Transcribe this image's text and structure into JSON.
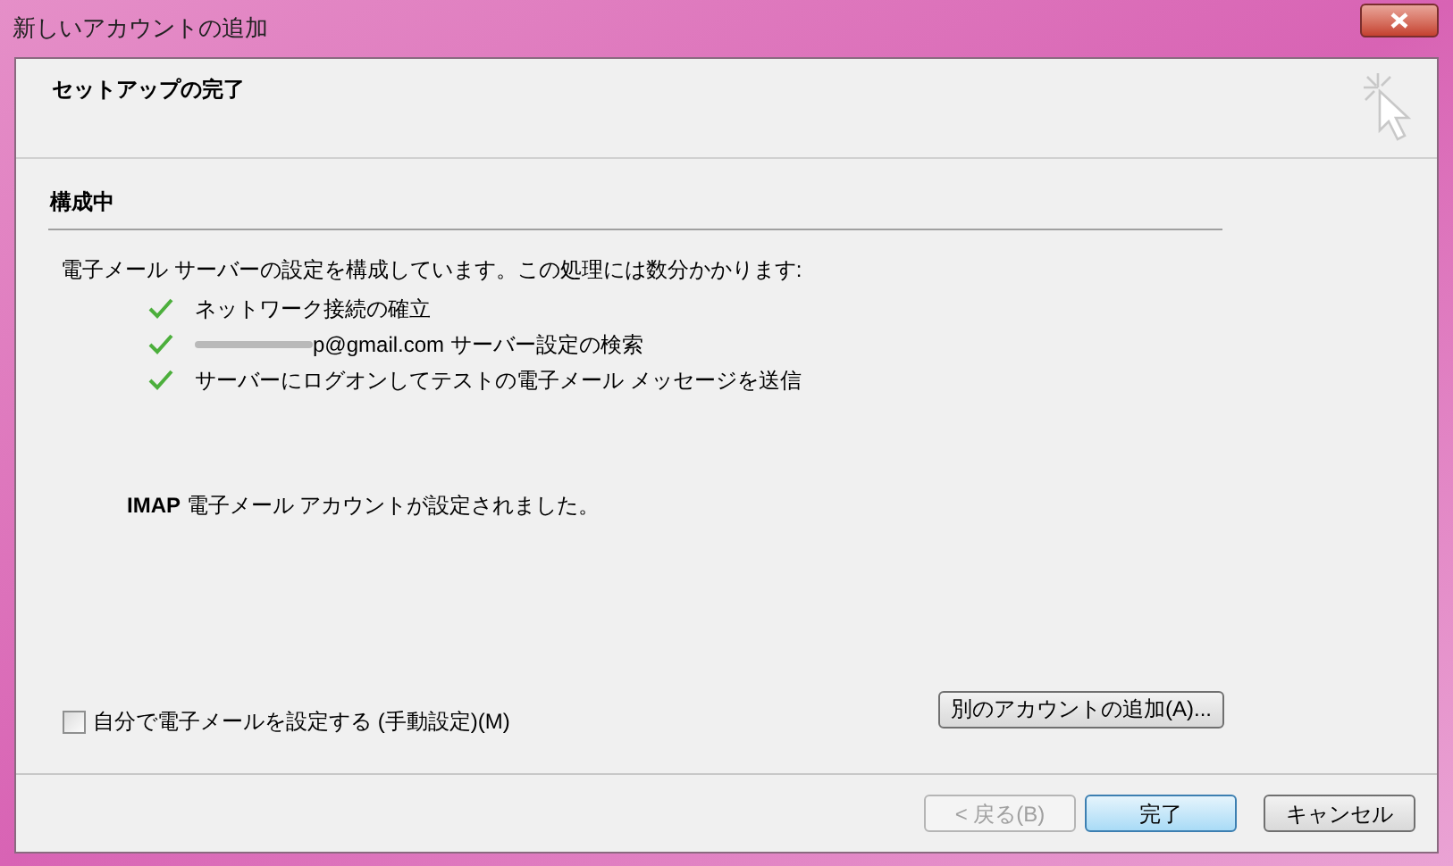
{
  "window": {
    "title": "新しいアカウントの追加"
  },
  "header": {
    "title": "セットアップの完了"
  },
  "section": {
    "title": "構成中",
    "intro": "電子メール サーバーの設定を構成しています。この処理には数分かかります:",
    "steps": [
      {
        "kind": "plain",
        "label": "ネットワーク接続の確立",
        "done": true
      },
      {
        "kind": "redacted",
        "label": "p@gmail.com サーバー設定の検索",
        "done": true
      },
      {
        "kind": "plain",
        "label": "サーバーにログオンしてテストの電子メール メッセージを送信",
        "done": true
      }
    ],
    "result": "**IMAP** 電子メール アカウントが設定されました。"
  },
  "manual_setup": {
    "label": "自分で電子メールを設定する (手動設定)(M)",
    "checked": false
  },
  "add_account_button": "別のアカウントの追加(A)...",
  "buttons": [
    {
      "label": "< 戻る(B)",
      "disabled": true,
      "default": false
    },
    {
      "label": "完了",
      "disabled": false,
      "default": true
    },
    {
      "label": "キャンセル",
      "disabled": false,
      "default": false
    }
  ]
}
